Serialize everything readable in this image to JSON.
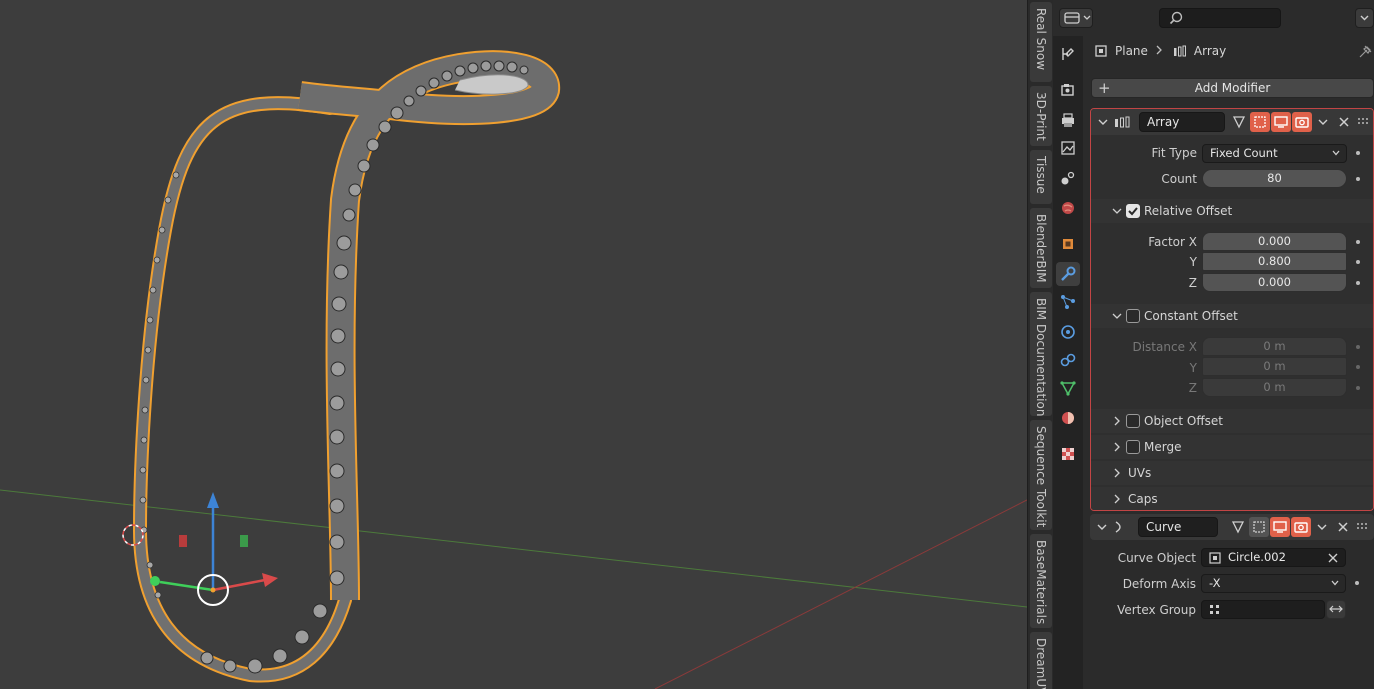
{
  "viewport": {
    "ntabs": [
      "Real Snow",
      "3D-Print",
      "Tissue",
      "BlenderBIM",
      "BIM Documentation",
      "Sequence Toolkit",
      "BaseMaterials",
      "DreamUV"
    ]
  },
  "props": {
    "breadcrumb": {
      "object": "Plane",
      "modifier": "Array"
    },
    "add_modifier_label": "Add Modifier",
    "array": {
      "name": "Array",
      "fit_type_label": "Fit Type",
      "fit_type_value": "Fixed Count",
      "count_label": "Count",
      "count_value": "80",
      "relative_offset_label": "Relative Offset",
      "relative_offset_checked": true,
      "factor_x_label": "Factor X",
      "factor_x": "0.000",
      "y_label": "Y",
      "factor_y": "0.800",
      "z_label": "Z",
      "factor_z": "0.000",
      "constant_offset_label": "Constant Offset",
      "constant_offset_checked": false,
      "distance_x_label": "Distance X",
      "distance_x": "0 m",
      "distance_y": "0 m",
      "distance_z": "0 m",
      "object_offset_label": "Object Offset",
      "merge_label": "Merge",
      "uvs_label": "UVs",
      "caps_label": "Caps"
    },
    "curve": {
      "name": "Curve",
      "curve_object_label": "Curve Object",
      "curve_object_value": "Circle.002",
      "deform_axis_label": "Deform Axis",
      "deform_axis_value": "-X",
      "vertex_group_label": "Vertex Group",
      "vertex_group_value": ""
    }
  },
  "colors": {
    "accent_active": "#e0614a",
    "selection_outline": "#f0a030",
    "panel_outline": "#c24545",
    "axis_x": "#d94a4a",
    "axis_y": "#3fcf5a",
    "axis_z": "#3d84d6"
  }
}
